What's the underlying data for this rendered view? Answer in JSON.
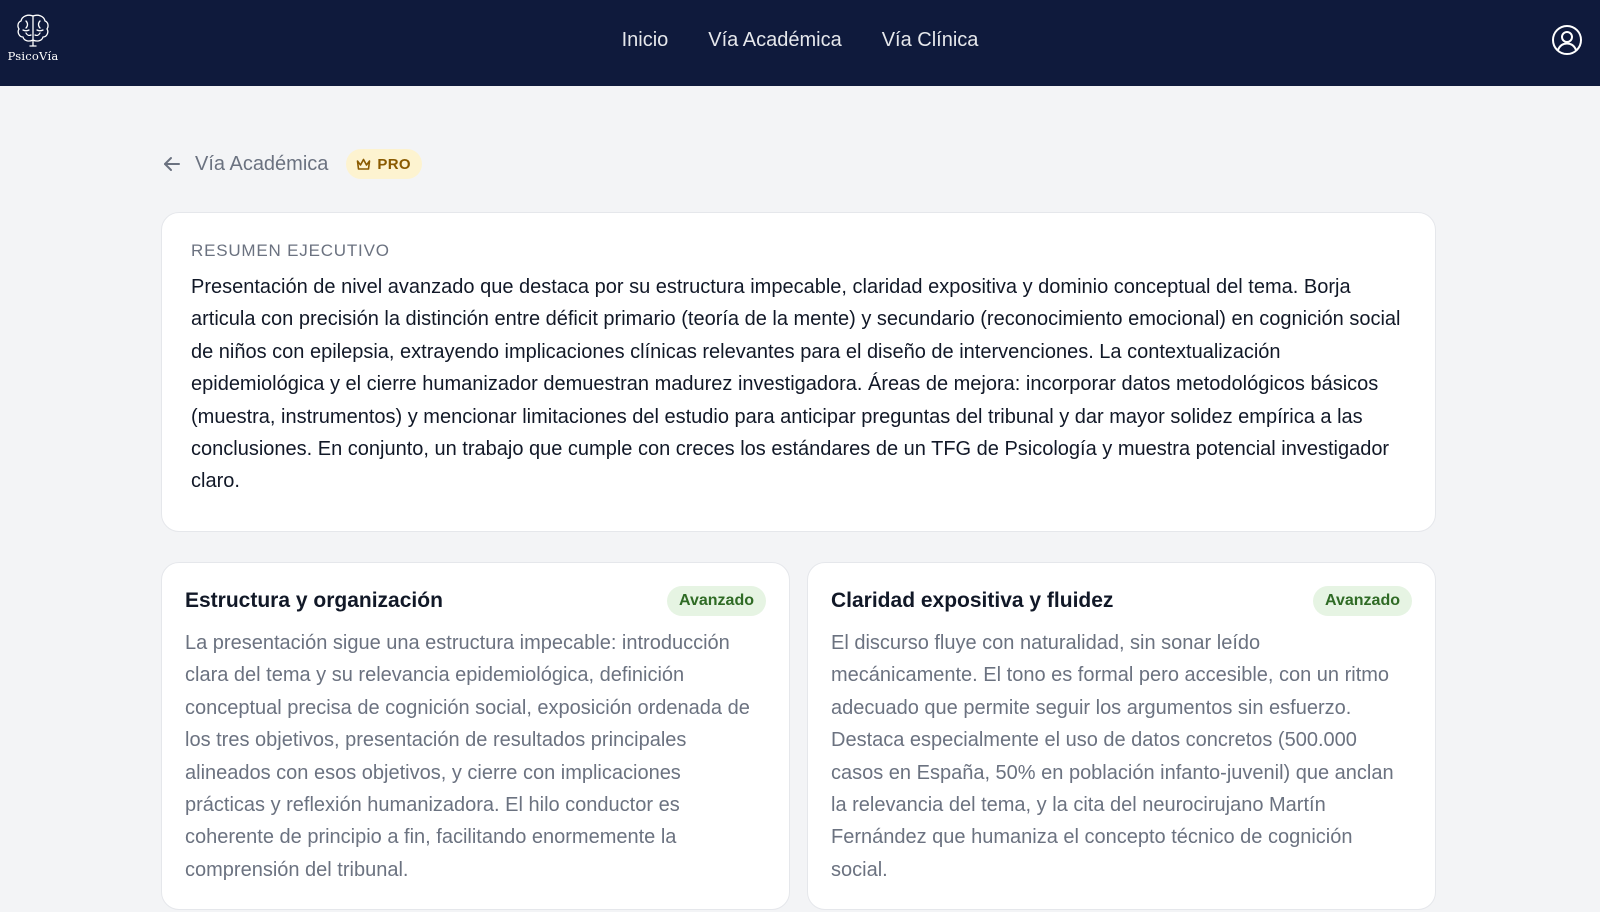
{
  "nav": {
    "brand": "PsicoVía",
    "links": [
      "Inicio",
      "Vía Académica",
      "Vía Clínica"
    ],
    "account_icon": "user-circle-icon"
  },
  "back": {
    "label": "Vía Académica",
    "icon": "arrow-left-icon"
  },
  "badge": {
    "label": "PRO",
    "icon": "crown-icon",
    "color": "#8a5a00",
    "background": "#fdf3d0"
  },
  "summary": {
    "label": "RESUMEN EJECUTIVO",
    "text": "Presentación de nivel avanzado que destaca por su estructura impecable, claridad expositiva y dominio conceptual del tema. Borja articula con precisión la distinción entre déficit primario (teoría de la mente) y secundario (reconocimiento emocional) en cognición social de niños con epilepsia, extrayendo implicaciones clínicas relevantes para el diseño de intervenciones. La contextualización epidemiológica y el cierre humanizador demuestran madurez investigadora. Áreas de mejora: incorporar datos metodológicos básicos (muestra, instrumentos) y mencionar limitaciones del estudio para anticipar preguntas del tribunal y dar mayor solidez empírica a las conclusiones. En conjunto, un trabajo que cumple con creces los estándares de un TFG de Psicología y muestra potencial investigador claro."
  },
  "criteria": [
    {
      "title": "Estructura y organización",
      "level": "Avanzado",
      "text": "La presentación sigue una estructura impecable: introducción clara del tema y su relevancia epidemiológica, definición conceptual precisa de cognición social, exposición ordenada de los tres objetivos, presentación de resultados principales alineados con esos objetivos, y cierre con implicaciones prácticas y reflexión humanizadora. El hilo conductor es coherente de principio a fin, facilitando enormemente la comprensión del tribunal."
    },
    {
      "title": "Claridad expositiva y fluidez",
      "level": "Avanzado",
      "text": "El discurso fluye con naturalidad, sin sonar leído mecánicamente. El tono es formal pero accesible, con un ritmo adecuado que permite seguir los argumentos sin esfuerzo. Destaca especialmente el uso de datos concretos (500.000 casos en España, 50% en población infanto-juvenil) que anclan la relevancia del tema, y la cita del neurocirujano Martín Fernández que humaniza el concepto técnico de cognición social."
    }
  ],
  "colors": {
    "navbar": "#0f1a3c",
    "page_background": "#f3f4f6",
    "level_badge_text": "#2f6b25",
    "level_badge_background": "#e6f4e3"
  }
}
